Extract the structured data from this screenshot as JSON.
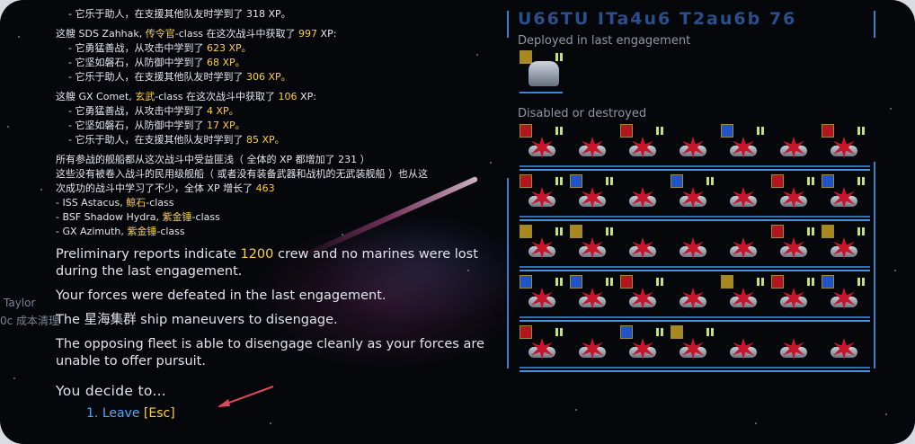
{
  "report": {
    "top_partial": "- 它乐于助人，在支援其他队友时学到了 318 XP。",
    "ships": [
      {
        "intro_prefix": "这艘 SDS Zahhak, ",
        "class_name": "传令官",
        "intro_middle": "-class 在这次战斗中获取了 ",
        "xp": "997",
        "intro_suffix": " XP:",
        "lines": [
          {
            "text": "- 它勇猛善战，从攻击中学到了 ",
            "xp": "623 XP。"
          },
          {
            "text": "- 它坚如磐石，从防御中学到了 ",
            "xp": "68 XP。"
          },
          {
            "text": "- 它乐于助人，在支援其他队友时学到了 ",
            "xp": "306 XP。"
          }
        ]
      },
      {
        "intro_prefix": "这艘 GX Comet, ",
        "class_name": "玄武",
        "intro_middle": "-class 在这次战斗中获取了 ",
        "xp": "106",
        "intro_suffix": " XP:",
        "lines": [
          {
            "text": "- 它勇猛善战，从攻击中学到了 ",
            "xp": "4 XP。"
          },
          {
            "text": "- 它坚如磐石，从防御中学到了 ",
            "xp": "17 XP。"
          },
          {
            "text": "- 它乐于助人，在支援其他队友时学到了 ",
            "xp": "85 XP。"
          }
        ]
      }
    ],
    "all_ships_line": "所有参战的舰船都从这次战斗中受益匪浅（ 全体的 XP 都增加了 231 ）",
    "civilian_line1": "这些没有被卷入战斗的民用级舰船（ 或者没有装备武器和战机的无武装舰船 ）也从这",
    "civilian_line2_prefix": "次成功的战斗中学习了不少，全体 XP 增长了 ",
    "civilian_xp": "463",
    "civilian_ships": [
      {
        "name": "- ISS Astacus, ",
        "cls": "鲸石",
        "suffix": "-class"
      },
      {
        "name": "- BSF Shadow Hydra, ",
        "cls": "紫金锤",
        "suffix": "-class"
      },
      {
        "name": "- GX Azimuth, ",
        "cls": "紫金锤",
        "suffix": "-class"
      }
    ]
  },
  "narrative": {
    "p1_prefix": "Preliminary reports indicate ",
    "p1_crew": "1200",
    "p1_suffix": " crew and no marines were lost during the last engagement.",
    "p2": "Your forces were defeated in the last engagement.",
    "p3": "The 星海集群 ship maneuvers to disengage.",
    "p4": "The opposing fleet is able to disengage cleanly as your forces are unable to offer pursuit."
  },
  "decision": {
    "prompt": "You decide to...",
    "options": [
      {
        "number": "1.",
        "label": "Leave",
        "hotkey": "[Esc]"
      }
    ]
  },
  "background_ghost": {
    "name": "Taylor",
    "line": "0c 成本清理"
  },
  "fleet_panel": {
    "ship_title": "U66TU ITa4u6 T2au6b 76",
    "deployed_label": "Deployed in last engagement",
    "disabled_label": "Disabled or destroyed"
  },
  "colors": {
    "highlight": "#ffcf33",
    "link": "#4aa8ff",
    "panel_line": "#3f7fc8"
  }
}
